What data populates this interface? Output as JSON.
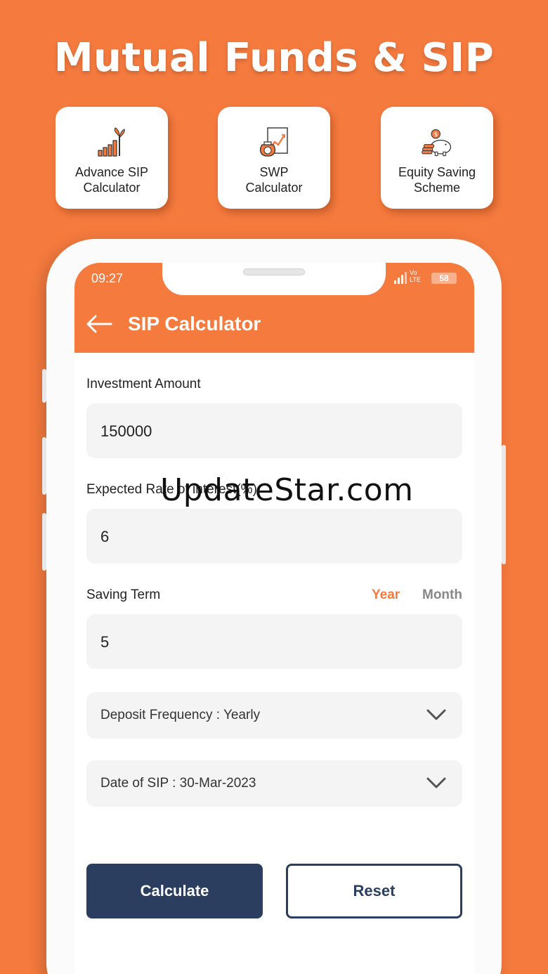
{
  "banner": {
    "title": "Mutual Funds & SIP"
  },
  "features": [
    {
      "label": "Advance SIP\nCalculator",
      "icon": "growth-chart-icon"
    },
    {
      "label": "SWP\nCalculator",
      "icon": "money-bag-chart-icon"
    },
    {
      "label": "Equity Saving\nScheme",
      "icon": "piggy-bank-icon"
    }
  ],
  "statusbar": {
    "time": "09:27",
    "network": "Vo\nLTE",
    "battery": "58"
  },
  "appbar": {
    "title": "SIP Calculator"
  },
  "form": {
    "investment_label": "Investment Amount",
    "investment_value": "150000",
    "rate_label": "Expected Rate of interest(%)",
    "rate_value": "6",
    "term_label": "Saving Term",
    "term_year": "Year",
    "term_month": "Month",
    "term_value": "5",
    "frequency": "Deposit Frequency : Yearly",
    "date": "Date of SIP : 30-Mar-2023"
  },
  "buttons": {
    "calculate": "Calculate",
    "reset": "Reset"
  },
  "watermark": "UpdateStar.com",
  "colors": {
    "accent": "#f47a3e",
    "primary_button": "#2c3e5f"
  }
}
